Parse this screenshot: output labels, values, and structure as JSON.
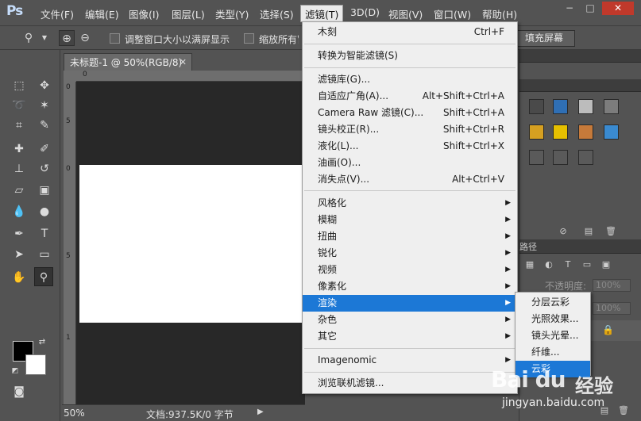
{
  "app": {
    "logo": "Ps"
  },
  "menubar": {
    "items": [
      "文件(F)",
      "编辑(E)",
      "图像(I)",
      "图层(L)",
      "类型(Y)",
      "选择(S)",
      "滤镜(T)",
      "3D(D)",
      "视图(V)",
      "窗口(W)",
      "帮助(H)"
    ],
    "active": "滤镜(T)"
  },
  "options": {
    "resize_windows_label": "调整窗口大小以满屏显示",
    "zoom_all_label": "缩放所有窗口",
    "fill_screen_label": "填充屏幕"
  },
  "document": {
    "tab_title": "未标题-1 @ 50%(RGB/8)",
    "ruler_h_ticks": [
      "0"
    ],
    "ruler_v_ticks": [
      "0",
      "5",
      "0",
      "5",
      "1"
    ]
  },
  "status": {
    "zoom": "50%",
    "doc_size": "文档:937.5K/0 字节"
  },
  "filter_menu": {
    "items": [
      {
        "label": "木刻",
        "shortcut": "Ctrl+F"
      },
      {
        "label": "转换为智能滤镜(S)"
      },
      {
        "label": "滤镜库(G)..."
      },
      {
        "label": "自适应广角(A)...",
        "shortcut": "Alt+Shift+Ctrl+A"
      },
      {
        "label": "Camera Raw 滤镜(C)...",
        "shortcut": "Shift+Ctrl+A"
      },
      {
        "label": "镜头校正(R)...",
        "shortcut": "Shift+Ctrl+R"
      },
      {
        "label": "液化(L)...",
        "shortcut": "Shift+Ctrl+X"
      },
      {
        "label": "油画(O)..."
      },
      {
        "label": "消失点(V)...",
        "shortcut": "Alt+Ctrl+V"
      },
      {
        "label": "风格化"
      },
      {
        "label": "模糊"
      },
      {
        "label": "扭曲"
      },
      {
        "label": "锐化"
      },
      {
        "label": "视频"
      },
      {
        "label": "像素化"
      },
      {
        "label": "渲染"
      },
      {
        "label": "杂色"
      },
      {
        "label": "其它"
      },
      {
        "label": "Imagenomic"
      },
      {
        "label": "浏览联机滤镜..."
      }
    ],
    "highlighted": "渲染"
  },
  "render_submenu": {
    "items": [
      "分层云彩",
      "光照效果...",
      "镜头光晕...",
      "纤维...",
      "云彩"
    ],
    "highlighted": "云彩"
  },
  "layers": {
    "opacity_label": "不透明度:",
    "opacity_value": "100%",
    "panel_tab_fragment": "路径"
  },
  "watermark": {
    "brand": "Bai du",
    "brand_cn": "经验",
    "url": "jingyan.baidu.com"
  },
  "swatch_colors": [
    "#4a4a4a",
    "#2f6fb5",
    "#bcbcbc",
    "#7c7c7c",
    "#d6a021",
    "#e6c000",
    "#c67a3a",
    "#3a8ad0"
  ]
}
